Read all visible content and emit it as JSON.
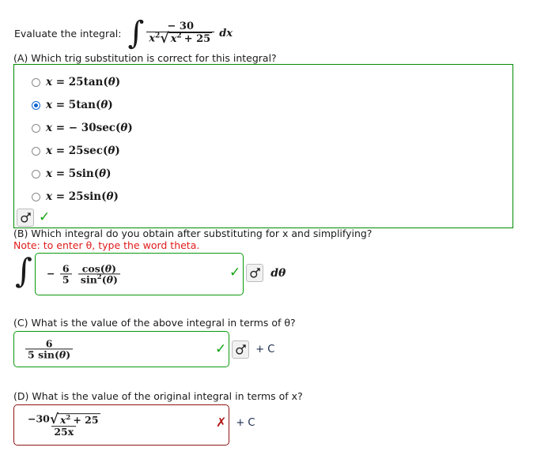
{
  "prompt": {
    "label": "Evaluate the integral:",
    "integral": {
      "numerator": "− 30",
      "denominator_x2": "x",
      "denominator_exp": "2",
      "radicand_x": "x",
      "radicand_exp": "2",
      "radicand_rest": "+ 25",
      "differential": "dx",
      "integral_sign": "∫"
    }
  },
  "partA": {
    "heading": "(A) Which trig substitution is correct for this integral?",
    "choices": [
      {
        "id": "choice-25tan",
        "lhs": "x",
        "eq": "=",
        "coef": "25",
        "fn": "tan",
        "arg": "θ",
        "selected": false,
        "negative": false
      },
      {
        "id": "choice-5tan",
        "lhs": "x",
        "eq": "=",
        "coef": "5",
        "fn": "tan",
        "arg": "θ",
        "selected": true,
        "negative": false
      },
      {
        "id": "choice-n30sec",
        "lhs": "x",
        "eq": "=",
        "coef": "30",
        "fn": "sec",
        "arg": "θ",
        "selected": false,
        "negative": true
      },
      {
        "id": "choice-25sec",
        "lhs": "x",
        "eq": "=",
        "coef": "25",
        "fn": "sec",
        "arg": "θ",
        "selected": false,
        "negative": false
      },
      {
        "id": "choice-5sin",
        "lhs": "x",
        "eq": "=",
        "coef": "5",
        "fn": "sin",
        "arg": "θ",
        "selected": false,
        "negative": false
      },
      {
        "id": "choice-25sin",
        "lhs": "x",
        "eq": "=",
        "coef": "25",
        "fn": "sin",
        "arg": "θ",
        "selected": false,
        "negative": false
      }
    ],
    "negative_sign": "−",
    "status": "correct",
    "status_mark": "✓"
  },
  "partB": {
    "heading": "(B) Which integral do you obtain after substituting for x and simplifying?",
    "note": "Note: to enter θ, type the word theta.",
    "integral_sign": "∫",
    "answer": {
      "sign": "−",
      "coef_num": "6",
      "coef_den": "5",
      "frac_num_fn": "cos",
      "frac_num_arg": "θ",
      "frac_den_fn": "sin",
      "frac_den_exp": "2",
      "frac_den_arg": "θ"
    },
    "differential": "dθ",
    "status": "correct",
    "status_mark": "✓"
  },
  "partC": {
    "heading": "(C) What is the value of the above integral in terms of θ?",
    "answer": {
      "num": "6",
      "den_coef": "5",
      "den_fn": "sin",
      "den_arg": "θ"
    },
    "suffix": "+ C",
    "status": "correct",
    "status_mark": "✓"
  },
  "partD": {
    "heading": "(D) What is the value of the original integral in terms of x?",
    "answer": {
      "num_coef": "−30",
      "radicand_var": "x",
      "radicand_exp": "2",
      "radicand_rest": "+ 25",
      "den": "25x"
    },
    "suffix": "+ C",
    "status": "incorrect",
    "status_mark": "✗"
  },
  "icons": {
    "preview_button": "mars-symbol-icon",
    "correct": "check-icon",
    "incorrect": "cross-icon"
  },
  "colors": {
    "correct_border": "#0a9a0a",
    "incorrect_border": "#8f1414",
    "note_text": "#e01b1b",
    "radio_selected": "#1166cc"
  }
}
